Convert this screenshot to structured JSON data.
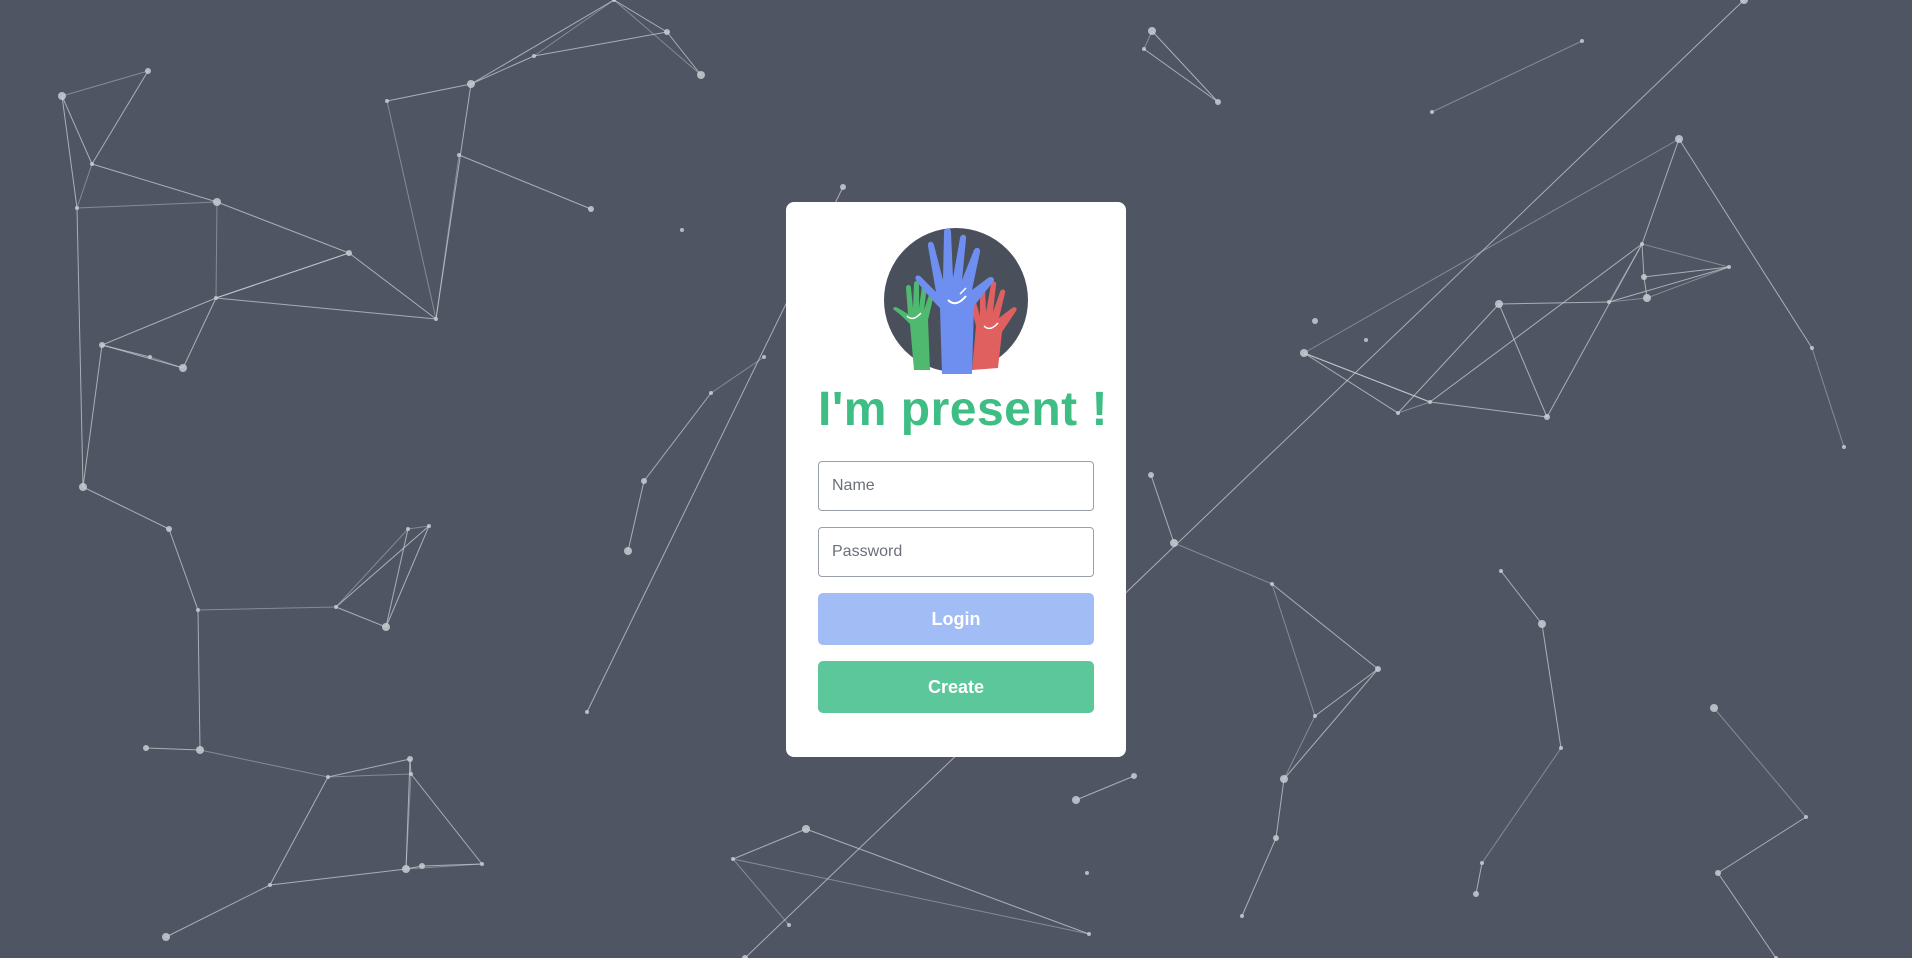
{
  "app": {
    "title": "I'm present !"
  },
  "logo": {
    "icon": "raised-hands-icon",
    "colors": {
      "circle": "#4a4f5c",
      "green_hand": "#4fb96f",
      "blue_hand": "#6f8ff0",
      "red_hand": "#e06060"
    }
  },
  "form": {
    "name": {
      "placeholder": "Name",
      "value": ""
    },
    "password": {
      "placeholder": "Password",
      "value": ""
    },
    "login_label": "Login",
    "create_label": "Create"
  },
  "colors": {
    "background": "#4f5563",
    "card": "#ffffff",
    "title": "#3ebd84",
    "login_button": "#a2bcf5",
    "create_button": "#5cc79a",
    "particles": "#c9ccd2"
  }
}
